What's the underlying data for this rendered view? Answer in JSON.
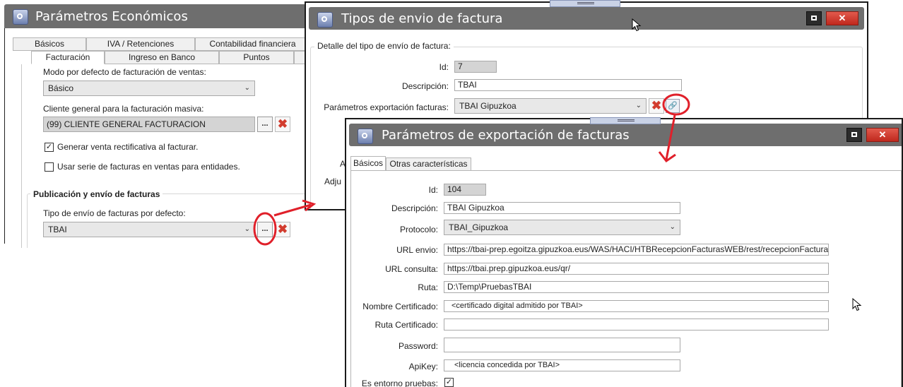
{
  "win1": {
    "title": "Parámetros Económicos",
    "tabs_row1": [
      "Básicos",
      "IVA / Retenciones",
      "Contabilidad financiera"
    ],
    "tabs_row2": [
      "Facturación",
      "Ingreso en Banco",
      "Puntos"
    ],
    "modo_label": "Modo por defecto de facturación de ventas:",
    "modo_value": "Básico",
    "cliente_label": "Cliente general para la facturación masiva:",
    "cliente_value": "(99) CLIENTE GENERAL FACTURACION",
    "chk1_label": "Generar venta rectificativa al facturar.",
    "chk1_checked": true,
    "chk2_label": "Usar serie de facturas en ventas para entidades.",
    "chk2_checked": false,
    "group_title": "Publicación y envío de facturas",
    "tipo_label": "Tipo de envío de facturas por defecto:",
    "tipo_value": "TBAI",
    "dots": "...",
    "clear": "✖"
  },
  "win2": {
    "title": "Tipos de envio de factura",
    "group_title": "Detalle del tipo de envío de factura:",
    "id_label": "Id:",
    "id_value": "7",
    "desc_label": "Descripción:",
    "desc_value": "TBAI",
    "param_label": "Parámetros exportación facturas:",
    "param_value": "TBAI Gipuzkoa",
    "partial_a": "A",
    "partial_adju": "Adju",
    "close": "✕"
  },
  "win3": {
    "title": "Parámetros de exportación de facturas",
    "tabs": [
      "Básicos",
      "Otras características"
    ],
    "fields": {
      "id": {
        "label": "Id:",
        "value": "104"
      },
      "descripcion": {
        "label": "Descripción:",
        "value": "TBAI Gipuzkoa"
      },
      "protocolo": {
        "label": "Protocolo:",
        "value": "TBAI_Gipuzkoa"
      },
      "url_envio": {
        "label": "URL envio:",
        "value": "https://tbai-prep.egoitza.gipuzkoa.eus/WAS/HACI/HTBRecepcionFacturasWEB/rest/recepcionFacturas/"
      },
      "url_consulta": {
        "label": "URL consulta:",
        "value": "https://tbai.prep.gipuzkoa.eus/qr/"
      },
      "ruta": {
        "label": "Ruta:",
        "value": "D:\\Temp\\PruebasTBAI"
      },
      "nombre_cert": {
        "label": "Nombre Certificado:",
        "value": "<certificado digital admitido por TBAI>"
      },
      "ruta_cert": {
        "label": "Ruta Certificado:",
        "value": ""
      },
      "password": {
        "label": "Password:",
        "value": ""
      },
      "apikey": {
        "label": "ApiKey:",
        "value": "<licencia concedida por TBAI>"
      },
      "entorno": {
        "label": "Es entorno pruebas:",
        "checked": true
      }
    },
    "close": "✕"
  },
  "colors": {
    "titlebar": "#6e6e6e",
    "annotation": "#e0202a",
    "close_button": "#d0372b"
  }
}
